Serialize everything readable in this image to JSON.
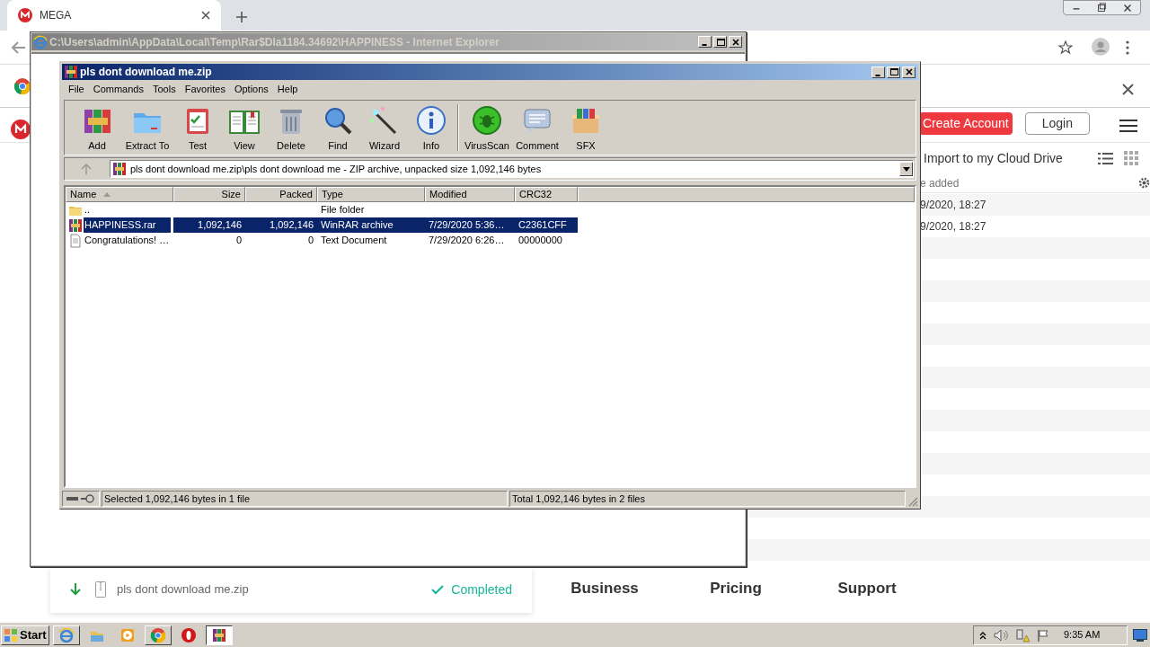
{
  "browser": {
    "tab": {
      "title": "MEGA"
    }
  },
  "mega": {
    "buttons": [
      {
        "label": "Create Account",
        "kind": "primary"
      },
      {
        "label": "Login",
        "kind": "secondary"
      }
    ],
    "import_label": "Import to my Cloud Drive",
    "column_header": "e added",
    "rows": [
      "9/2020, 18:27",
      "9/2020, 18:27"
    ],
    "download": {
      "file": "pls dont download me.zip",
      "status": "Completed"
    },
    "nav": [
      "Business",
      "Pricing",
      "Support"
    ]
  },
  "ie_window": {
    "title": "C:\\Users\\admin\\AppData\\Local\\Temp\\Rar$DIa1184.34692\\HAPPINESS - Internet Explorer",
    "active": false
  },
  "winrar": {
    "title": "pls dont download me.zip",
    "active": true,
    "menu": [
      "File",
      "Commands",
      "Tools",
      "Favorites",
      "Options",
      "Help"
    ],
    "toolbar": [
      {
        "label": "Add",
        "kind": "add"
      },
      {
        "label": "Extract To",
        "kind": "extract"
      },
      {
        "label": "Test",
        "kind": "test"
      },
      {
        "label": "View",
        "kind": "view"
      },
      {
        "label": "Delete",
        "kind": "delete"
      },
      {
        "label": "Find",
        "kind": "find"
      },
      {
        "label": "Wizard",
        "kind": "wizard"
      },
      {
        "label": "Info",
        "kind": "info"
      },
      {
        "label": "VirusScan",
        "kind": "virus"
      },
      {
        "label": "Comment",
        "kind": "comment"
      },
      {
        "label": "SFX",
        "kind": "sfx"
      }
    ],
    "path": "pls dont download me.zip\\pls dont download me - ZIP archive, unpacked size 1,092,146 bytes",
    "columns": [
      {
        "label": "Name",
        "sorted": true,
        "numeric": false
      },
      {
        "label": "Size",
        "sorted": false,
        "numeric": true
      },
      {
        "label": "Packed",
        "sorted": false,
        "numeric": true
      },
      {
        "label": "Type",
        "sorted": false,
        "numeric": false
      },
      {
        "label": "Modified",
        "sorted": false,
        "numeric": false
      },
      {
        "label": "CRC32",
        "sorted": false,
        "numeric": false
      }
    ],
    "rows": [
      {
        "kind": "folder",
        "selected": false,
        "cells": [
          "..",
          null,
          null,
          "File folder",
          null,
          null
        ]
      },
      {
        "kind": "rar",
        "selected": true,
        "cells": [
          "HAPPINESS.rar",
          "1,092,146",
          "1,092,146",
          "WinRAR archive",
          "7/29/2020 5:36…",
          "C2361CFF"
        ]
      },
      {
        "kind": "text",
        "selected": false,
        "cells": [
          "Congratulations! …",
          "0",
          "0",
          "Text Document",
          "7/29/2020 6:26…",
          "00000000"
        ]
      }
    ],
    "status_left": "Selected 1,092,146 bytes in 1 file",
    "status_right": "Total 1,092,146 bytes in 2 files"
  },
  "taskbar": {
    "start": "Start",
    "apps": [
      {
        "kind": "ie",
        "open": true,
        "selected": false
      },
      {
        "kind": "explorer",
        "open": false,
        "selected": false
      },
      {
        "kind": "media",
        "open": false,
        "selected": false
      },
      {
        "kind": "chrome",
        "open": true,
        "selected": false
      },
      {
        "kind": "opera",
        "open": false,
        "selected": false
      },
      {
        "kind": "winrar",
        "open": true,
        "selected": true
      }
    ],
    "clock": "9:35 AM"
  }
}
